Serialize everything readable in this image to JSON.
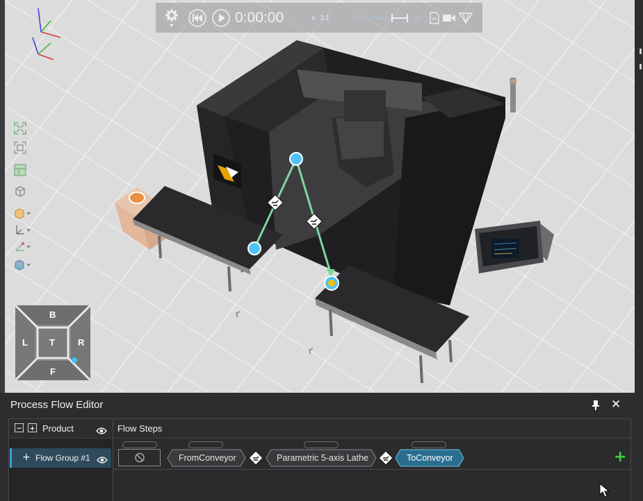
{
  "playback": {
    "settings_icon": "gear-icon",
    "rewind_icon": "rewind-icon",
    "play_icon": "play-icon",
    "time": "0:00:00",
    "speed": "x 11",
    "record_icon": "video-camera-icon",
    "pdf_icon": "pdf-icon"
  },
  "navcube": {
    "top": "B",
    "left": "L",
    "center": "T",
    "right": "R",
    "bottom": "F"
  },
  "panel": {
    "title": "Process Flow Editor",
    "product_header": "Product",
    "flow_steps_header": "Flow Steps",
    "flow_group_label": "Flow Group #1",
    "steps": [
      {
        "label": "FromConveyor",
        "selected": false
      },
      {
        "label": "Parametric 5-axis Lathe",
        "selected": false
      },
      {
        "label": "ToConveyor",
        "selected": true
      }
    ],
    "add_icon": "plus-icon"
  },
  "colors": {
    "accent": "#3aa1d6",
    "selected_step": "#2a6e8f",
    "add_green": "#3fcf3f",
    "path_line": "#7fd6a0",
    "waypoint": "#4fc3f7",
    "target": "#f2c200"
  }
}
